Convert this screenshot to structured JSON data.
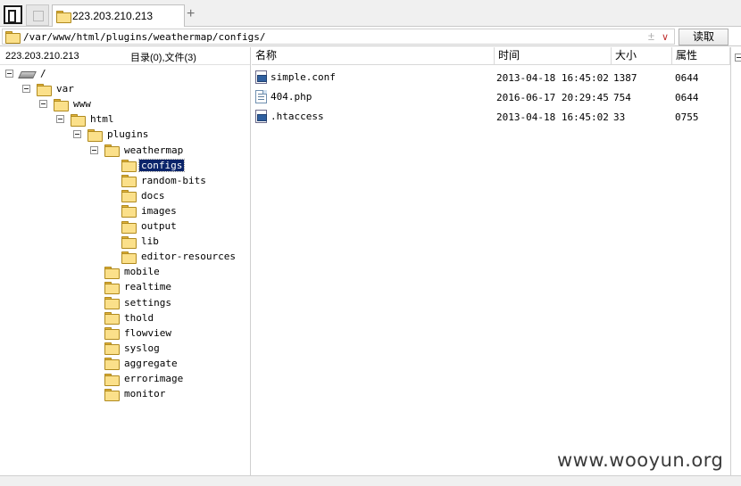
{
  "tab": {
    "label": "223.203.210.213"
  },
  "address": {
    "path": "/var/www/html/plugins/weathermap/configs/",
    "read_label": "读取"
  },
  "left_panel": {
    "host": "223.203.210.213",
    "counts": "目录(0),文件(3)"
  },
  "tree": [
    {
      "label": "/",
      "level": 0,
      "expanded": true,
      "icon": "drive-icon"
    },
    {
      "label": "var",
      "level": 1,
      "expanded": true
    },
    {
      "label": "www",
      "level": 2,
      "expanded": true
    },
    {
      "label": "html",
      "level": 3,
      "expanded": true
    },
    {
      "label": "plugins",
      "level": 4,
      "expanded": true
    },
    {
      "label": "weathermap",
      "level": 5,
      "expanded": true
    },
    {
      "label": "configs",
      "level": 6,
      "selected": true
    },
    {
      "label": "random-bits",
      "level": 6
    },
    {
      "label": "docs",
      "level": 6
    },
    {
      "label": "images",
      "level": 6
    },
    {
      "label": "output",
      "level": 6
    },
    {
      "label": "lib",
      "level": 6
    },
    {
      "label": "editor-resources",
      "level": 6
    },
    {
      "label": "mobile",
      "level": 5
    },
    {
      "label": "realtime",
      "level": 5
    },
    {
      "label": "settings",
      "level": 5
    },
    {
      "label": "thold",
      "level": 5
    },
    {
      "label": "flowview",
      "level": 5
    },
    {
      "label": "syslog",
      "level": 5
    },
    {
      "label": "aggregate",
      "level": 5
    },
    {
      "label": "errorimage",
      "level": 5
    },
    {
      "label": "monitor",
      "level": 5
    }
  ],
  "columns": {
    "name": "名称",
    "time": "时间",
    "size": "大小",
    "attr": "属性"
  },
  "files": [
    {
      "name": "simple.conf",
      "time": "2013-04-18 16:45:02",
      "size": "1387",
      "attr": "0644",
      "icon": "conf-file-icon"
    },
    {
      "name": "404.php",
      "time": "2016-06-17 20:29:45",
      "size": "754",
      "attr": "0644",
      "icon": "php-file-icon"
    },
    {
      "name": ".htaccess",
      "time": "2013-04-18 16:45:02",
      "size": "33",
      "attr": "0755",
      "icon": "conf-file-icon"
    }
  ],
  "watermark": "www.wooyun.org",
  "colors": {
    "selection": "#0a246a",
    "folder": "#fbe08a",
    "star": "#b0b0b0",
    "dropdown": "#c03030"
  }
}
